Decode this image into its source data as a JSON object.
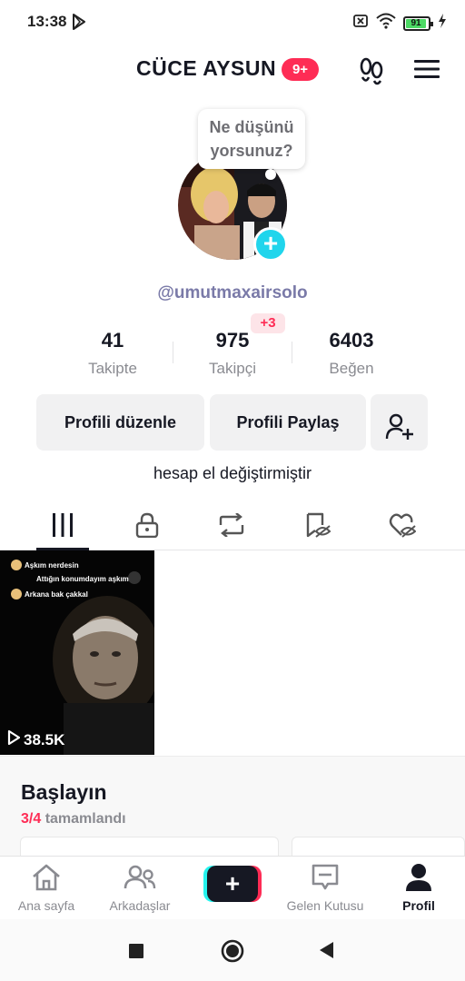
{
  "status_bar": {
    "time": "13:38",
    "battery": "91"
  },
  "header": {
    "username": "CÜCE AYSUN",
    "notification_badge": "9+"
  },
  "profile": {
    "bubble_text": "Ne düşünü yorsunuz?",
    "handle": "@umutmaxairsolo",
    "stats": [
      {
        "value": "41",
        "label": "Takipte"
      },
      {
        "value": "975",
        "label": "Takipçi",
        "badge": "+3"
      },
      {
        "value": "6403",
        "label": "Beğen"
      }
    ],
    "buttons": {
      "edit": "Profili düzenle",
      "share": "Profili Paylaş"
    },
    "bio": "hesap el değiştirmiştir"
  },
  "tabs": [
    "videos-grid-icon",
    "lock-icon",
    "repost-icon",
    "hidden-icon",
    "liked-icon"
  ],
  "video": {
    "chat": [
      "Aşkım nerdesin",
      "Attığın konumdayım aşkım",
      "Arkana bak çakkal"
    ],
    "views": "38.5K"
  },
  "start_panel": {
    "title": "Başlayın",
    "progress_count": "3/4",
    "progress_text": "tamamlandı"
  },
  "bottom_nav": [
    {
      "label": "Ana sayfa",
      "icon": "home-icon"
    },
    {
      "label": "Arkadaşlar",
      "icon": "friends-icon"
    },
    {
      "label": "Gelen Kutusu",
      "icon": "inbox-icon"
    },
    {
      "label": "Profil",
      "icon": "profile-icon"
    }
  ],
  "colors": {
    "accent": "#fe2c55",
    "cyan": "#20d5ec",
    "handle": "#7a7aa8"
  }
}
